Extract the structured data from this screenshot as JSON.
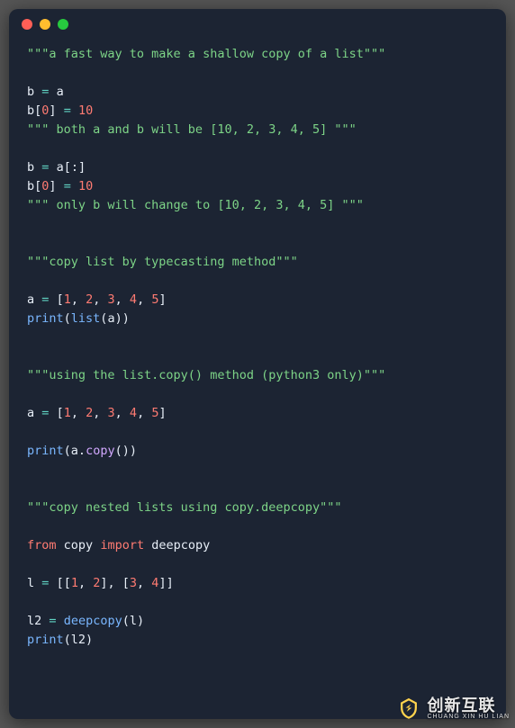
{
  "watermark": {
    "brand": "创新互联",
    "sub": "CHUANG XIN HU LIAN"
  },
  "code": {
    "tokens": [
      [
        [
          "\"\"\"a fast way to make a shallow copy of a list\"\"\"",
          "str"
        ]
      ],
      [],
      [
        [
          "b",
          "var"
        ],
        [
          " ",
          "var"
        ],
        [
          "=",
          "op"
        ],
        [
          " ",
          "var"
        ],
        [
          "a",
          "var"
        ]
      ],
      [
        [
          "b",
          "var"
        ],
        [
          "[",
          "punc"
        ],
        [
          "0",
          "num"
        ],
        [
          "]",
          "punc"
        ],
        [
          " ",
          "var"
        ],
        [
          "=",
          "op"
        ],
        [
          " ",
          "var"
        ],
        [
          "10",
          "num"
        ]
      ],
      [
        [
          "\"\"\" both a and b will be [10, 2, 3, 4, 5] \"\"\"",
          "str"
        ]
      ],
      [],
      [
        [
          "b",
          "var"
        ],
        [
          " ",
          "var"
        ],
        [
          "=",
          "op"
        ],
        [
          " ",
          "var"
        ],
        [
          "a",
          "var"
        ],
        [
          "[:]",
          "punc"
        ]
      ],
      [
        [
          "b",
          "var"
        ],
        [
          "[",
          "punc"
        ],
        [
          "0",
          "num"
        ],
        [
          "]",
          "punc"
        ],
        [
          " ",
          "var"
        ],
        [
          "=",
          "op"
        ],
        [
          " ",
          "var"
        ],
        [
          "10",
          "num"
        ]
      ],
      [
        [
          "\"\"\" only b will change to [10, 2, 3, 4, 5] \"\"\"",
          "str"
        ]
      ],
      [],
      [],
      [
        [
          "\"\"\"copy list by typecasting method\"\"\"",
          "str"
        ]
      ],
      [],
      [
        [
          "a",
          "var"
        ],
        [
          " ",
          "var"
        ],
        [
          "=",
          "op"
        ],
        [
          " ",
          "var"
        ],
        [
          "[",
          "punc"
        ],
        [
          "1",
          "num"
        ],
        [
          ", ",
          "punc"
        ],
        [
          "2",
          "num"
        ],
        [
          ", ",
          "punc"
        ],
        [
          "3",
          "num"
        ],
        [
          ", ",
          "punc"
        ],
        [
          "4",
          "num"
        ],
        [
          ", ",
          "punc"
        ],
        [
          "5",
          "num"
        ],
        [
          "]",
          "punc"
        ]
      ],
      [
        [
          "print",
          "func"
        ],
        [
          "(",
          "punc"
        ],
        [
          "list",
          "func"
        ],
        [
          "(",
          "punc"
        ],
        [
          "a",
          "var"
        ],
        [
          "))",
          "punc"
        ]
      ],
      [],
      [],
      [
        [
          "\"\"\"using the list.copy() method (python3 only)\"\"\"",
          "str"
        ]
      ],
      [],
      [
        [
          "a",
          "var"
        ],
        [
          " ",
          "var"
        ],
        [
          "=",
          "op"
        ],
        [
          " ",
          "var"
        ],
        [
          "[",
          "punc"
        ],
        [
          "1",
          "num"
        ],
        [
          ", ",
          "punc"
        ],
        [
          "2",
          "num"
        ],
        [
          ", ",
          "punc"
        ],
        [
          "3",
          "num"
        ],
        [
          ", ",
          "punc"
        ],
        [
          "4",
          "num"
        ],
        [
          ", ",
          "punc"
        ],
        [
          "5",
          "num"
        ],
        [
          "]",
          "punc"
        ]
      ],
      [],
      [
        [
          "print",
          "func"
        ],
        [
          "(",
          "punc"
        ],
        [
          "a",
          "var"
        ],
        [
          ".",
          "punc"
        ],
        [
          "copy",
          "meth"
        ],
        [
          "())",
          "punc"
        ]
      ],
      [],
      [],
      [
        [
          "\"\"\"copy nested lists using copy.deepcopy\"\"\"",
          "str"
        ]
      ],
      [],
      [
        [
          "from",
          "kw"
        ],
        [
          " ",
          "var"
        ],
        [
          "copy",
          "var"
        ],
        [
          " ",
          "var"
        ],
        [
          "import",
          "kw"
        ],
        [
          " ",
          "var"
        ],
        [
          "deepcopy",
          "var"
        ]
      ],
      [],
      [
        [
          "l",
          "var"
        ],
        [
          " ",
          "var"
        ],
        [
          "=",
          "op"
        ],
        [
          " ",
          "var"
        ],
        [
          "[[",
          "punc"
        ],
        [
          "1",
          "num"
        ],
        [
          ", ",
          "punc"
        ],
        [
          "2",
          "num"
        ],
        [
          "], [",
          "punc"
        ],
        [
          "3",
          "num"
        ],
        [
          ", ",
          "punc"
        ],
        [
          "4",
          "num"
        ],
        [
          "]]",
          "punc"
        ]
      ],
      [],
      [
        [
          "l2",
          "var"
        ],
        [
          " ",
          "var"
        ],
        [
          "=",
          "op"
        ],
        [
          " ",
          "var"
        ],
        [
          "deepcopy",
          "func"
        ],
        [
          "(",
          "punc"
        ],
        [
          "l",
          "var"
        ],
        [
          ")",
          "punc"
        ]
      ],
      [
        [
          "print",
          "func"
        ],
        [
          "(",
          "punc"
        ],
        [
          "l2",
          "var"
        ],
        [
          ")",
          "punc"
        ]
      ]
    ]
  }
}
